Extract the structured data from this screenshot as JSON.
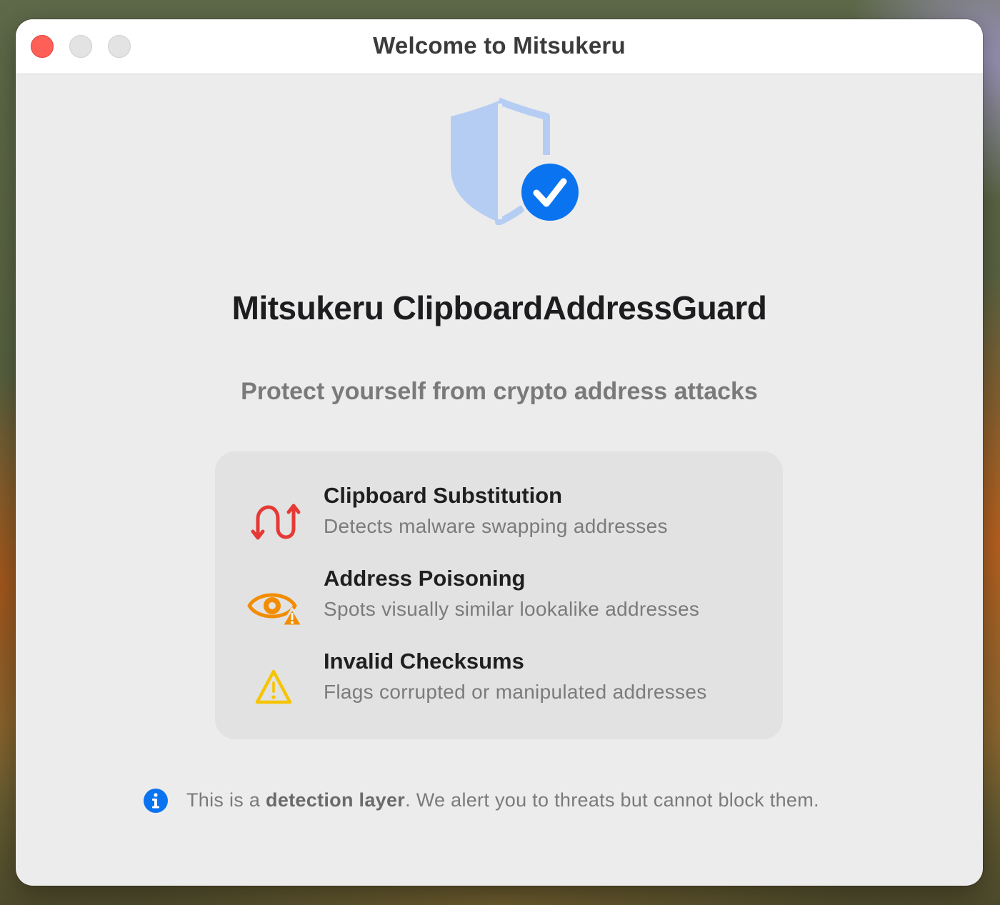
{
  "window": {
    "title": "Welcome to Mitsukeru"
  },
  "header": {
    "app_name": "Mitsukeru ClipboardAddressGuard",
    "tagline": "Protect yourself from crypto address attacks"
  },
  "features": [
    {
      "title": "Clipboard Substitution",
      "description": "Detects malware swapping addresses",
      "icon": "arrow-swap-icon",
      "color": "#e53935"
    },
    {
      "title": "Address Poisoning",
      "description": "Spots visually similar lookalike addresses",
      "icon": "eye-warning-icon",
      "color": "#f28c00"
    },
    {
      "title": "Invalid Checksums",
      "description": "Flags corrupted or manipulated addresses",
      "icon": "warning-triangle-icon",
      "color": "#f6c400"
    }
  ],
  "note": {
    "icon": "info-icon",
    "prefix": "This is a ",
    "emphasis": "detection layer",
    "suffix": ". We alert you to threats but cannot block them."
  },
  "colors": {
    "accent": "#0a74f0",
    "shield": "#b6cdf3",
    "close": "#fe5f57"
  }
}
